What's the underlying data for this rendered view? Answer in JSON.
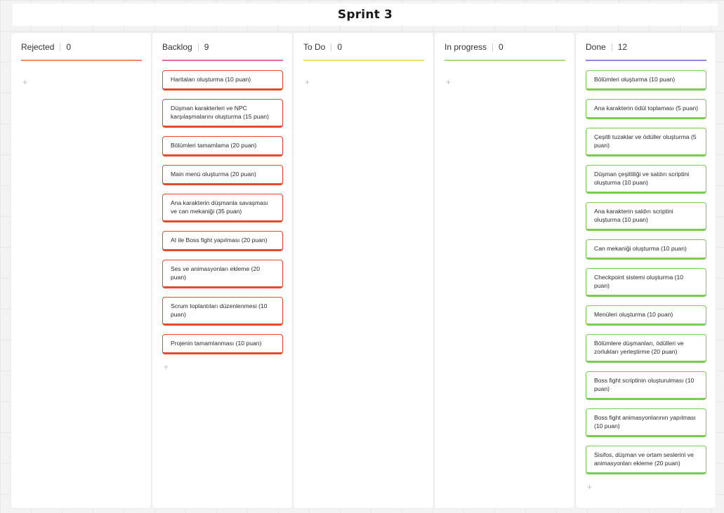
{
  "board": {
    "title": "Sprint 3",
    "add_symbol": "+",
    "columns": [
      {
        "name": "Rejected",
        "count": "0",
        "color": "#f08a73",
        "card_color": "red",
        "cards": []
      },
      {
        "name": "Backlog",
        "count": "9",
        "color": "#e66ba4",
        "card_color": "red",
        "cards": [
          "Haritaları oluşturma (10 puan)",
          "Düşman karakterleri ve NPC karşılaşmalarını oluşturma (15 puan)",
          "Bölümleri tamamlama (20 puan)",
          "Main menü oluşturma (20 puan)",
          "Ana karakterin düşmanla savaşması ve can mekaniği (35 puan)",
          "AI ile Boss fight yapılması (20 puan)",
          "Ses ve animasyonları ekleme (20 puan)",
          "Scrum toplantıları düzenlenmesi (10 puan)",
          "Projenin tamamlanması (10 puan)"
        ]
      },
      {
        "name": "To Do",
        "count": "0",
        "color": "#f4e06d",
        "card_color": "red",
        "cards": []
      },
      {
        "name": "In progress",
        "count": "0",
        "color": "#a7d98a",
        "card_color": "red",
        "cards": []
      },
      {
        "name": "Done",
        "count": "12",
        "color": "#8f8ae0",
        "card_color": "green",
        "cards": [
          "Bölümleri oluşturma  (10 puan)",
          "Ana karakterin ödül toplaması (5 puan)",
          "Çeşitli tuzaklar ve ödüller oluşturma (5 puan)",
          "Düşman çeşitliliği ve saldırı scriptini oluşturma (10 puan)",
          "Ana karakterin saldırı scriptini oluşturma (10 puan)",
          "Can mekaniği oluşturma (10 puan)",
          "Checkpoint sistemi oluşturma (10 puan)",
          "Menüleri oluşturma (10 puan)",
          "Bölümlere düşmanları, ödülleri ve zorlukları yerleştirme (20 puan)",
          "Boss fight scriptinin oluşturulması (10 puan)",
          "Boss fight animasyonlarının yapılması (10 puan)",
          "Sisifos, düşman ve ortam seslerini ve animasyonları ekleme (20 puan)"
        ]
      }
    ]
  }
}
